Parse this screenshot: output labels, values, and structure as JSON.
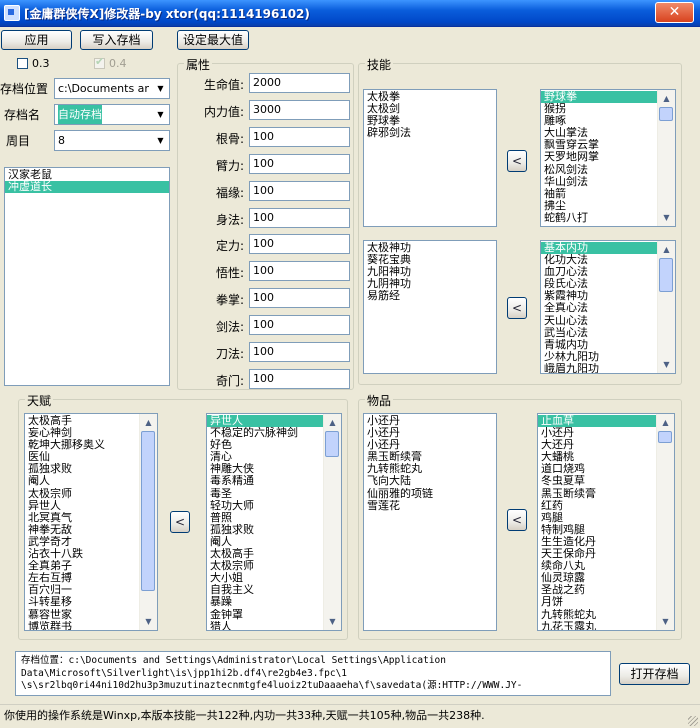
{
  "window": {
    "title": "[金庸群侠传X]修改器-by xtor(qq:1114196102)",
    "close_glyph": "✕"
  },
  "toolbar": {
    "apply": "应用",
    "write_save": "写入存档",
    "set_max": "设定最大值"
  },
  "checks": {
    "v03": "0.3",
    "v04": "0.4"
  },
  "left": {
    "save_location_label": "存档位置",
    "save_location_value": "c:\\Documents and",
    "save_name_label": "存档名",
    "save_name_value": "自动存档",
    "week_label": "周目",
    "week_value": "8",
    "characters": [
      "汉家老鼠",
      "冲虚道长"
    ]
  },
  "attributes": {
    "title": "属性",
    "rows": [
      {
        "label": "生命值:",
        "value": "2000"
      },
      {
        "label": "内力值:",
        "value": "3000"
      },
      {
        "label": "根骨:",
        "value": "100"
      },
      {
        "label": "臂力:",
        "value": "100"
      },
      {
        "label": "福缘:",
        "value": "100"
      },
      {
        "label": "身法:",
        "value": "100"
      },
      {
        "label": "定力:",
        "value": "100"
      },
      {
        "label": "悟性:",
        "value": "100"
      },
      {
        "label": "拳掌:",
        "value": "100"
      },
      {
        "label": "剑法:",
        "value": "100"
      },
      {
        "label": "刀法:",
        "value": "100"
      },
      {
        "label": "奇门:",
        "value": "100"
      }
    ]
  },
  "skills": {
    "title": "技能",
    "owned": [
      "太极拳",
      "太极剑",
      "野球拳",
      "辟邪剑法"
    ],
    "available": [
      "野球拳",
      "猴拐",
      "雕啄",
      "大山掌法",
      "飘雪穿云掌",
      "天罗地网掌",
      "松风剑法",
      "华山剑法",
      "袖箭",
      "拂尘",
      "蛇鹤八打"
    ],
    "add_arrow": "<"
  },
  "internal": {
    "owned": [
      "太极神功",
      "葵花宝典",
      "九阳神功",
      "九阴神功",
      "易筋经"
    ],
    "available": [
      "基本内功",
      "化功大法",
      "血刀心法",
      "段氏心法",
      "紫霞神功",
      "全真心法",
      "天山心法",
      "武当心法",
      "青城内功",
      "少林九阳功",
      "峨眉九阳功"
    ],
    "add_arrow": "<"
  },
  "talents": {
    "title": "天赋",
    "owned": [
      "太极高手",
      "妄心神剑",
      "乾坤大挪移奥义",
      "医仙",
      "孤独求败",
      "阉人",
      "太极宗师",
      "异世人",
      "北冥真气",
      "神拳无敌",
      "武学奇才",
      "沾衣十八跌",
      "全真弟子",
      "左右互搏",
      "百穴归一",
      "斗转星移",
      "慕容世家",
      "博览群书"
    ],
    "available": [
      "异世人",
      "不稳定的六脉神剑",
      "好色",
      "清心",
      "神雕大侠",
      "毒系精通",
      "毒圣",
      "轻功大师",
      "普照",
      "孤独求败",
      "阉人",
      "太极高手",
      "太极宗师",
      "大小姐",
      "自我主义",
      "暴躁",
      "金钟罩",
      "猎人"
    ],
    "add_arrow": "<"
  },
  "items": {
    "title": "物品",
    "owned": [
      "小还丹",
      "小还丹",
      "小还丹",
      "黑玉断续膏",
      "九转熊蛇丸",
      "飞向大陆",
      "仙丽雅的项链",
      "雪莲花"
    ],
    "available": [
      "止血草",
      "小还丹",
      "大还丹",
      "大蟠桃",
      "道口烧鸡",
      "冬虫夏草",
      "黑玉断续膏",
      "红药",
      "鸡腿",
      "特制鸡腿",
      "生生造化丹",
      "天王保命丹",
      "续命八丸",
      "仙灵琼露",
      "圣战之药",
      "月饼",
      "九转熊蛇丸",
      "九花玉露丸"
    ],
    "add_arrow": "<"
  },
  "path": {
    "text": "存档位置：c:\\Documents and Settings\\Administrator\\Local Settings\\Application\nData\\Microsoft\\Silverlight\\is\\jpp1hi2b.df4\\re2gb4e3.fpc\\1\n\\s\\sr2lbq0ri44ni10d2hu3p3muzutinaztecnmtgfe4luoiz2tuDaaaeha\\f\\savedata(源:HTTP://WWW.JY-",
    "open_button": "打开存档"
  },
  "status": {
    "text": "你使用的操作系统是Winxp,本版本技能一共122种,内功一共33种,天赋一共105种,物品一共238种."
  }
}
